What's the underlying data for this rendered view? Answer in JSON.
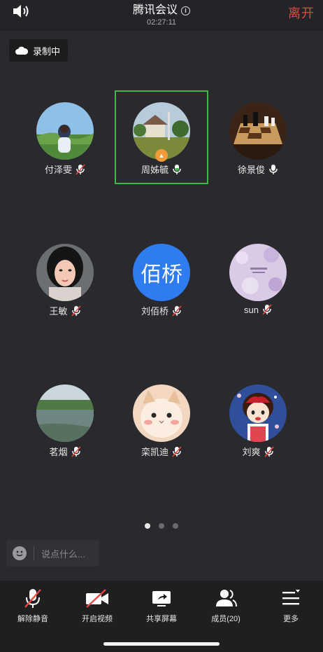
{
  "header": {
    "title": "腾讯会议",
    "timer": "02:27:11",
    "leave_label": "离开"
  },
  "recording": {
    "label": "录制中"
  },
  "participants": [
    {
      "name": "付泽雯",
      "mic": "muted"
    },
    {
      "name": "周姊毓",
      "mic": "speaking"
    },
    {
      "name": "徐景俊",
      "mic": "on"
    },
    {
      "name": "王敏",
      "mic": "muted"
    },
    {
      "name": "刘佰桥",
      "mic": "muted",
      "avatar_text": "佰桥"
    },
    {
      "name": "sun",
      "mic": "muted"
    },
    {
      "name": "茗烟",
      "mic": "muted"
    },
    {
      "name": "栾凯迪",
      "mic": "muted"
    },
    {
      "name": "刘爽",
      "mic": "muted"
    }
  ],
  "pagination": {
    "current": 1,
    "total": 3
  },
  "chat": {
    "placeholder": "说点什么..."
  },
  "toolbar": {
    "unmute": "解除静音",
    "video": "开启视频",
    "share": "共享屏幕",
    "members": "成员(20)",
    "more": "更多"
  },
  "colors": {
    "accent_green": "#3fb74b",
    "leave_red": "#e5483f",
    "avatar_blue": "#2f7bf0"
  }
}
